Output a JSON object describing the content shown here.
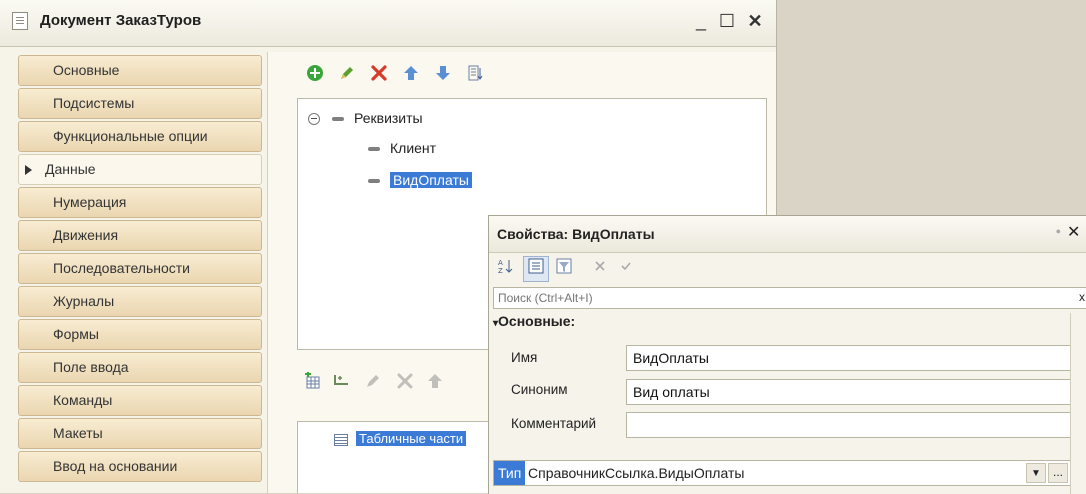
{
  "window": {
    "title": "Документ ЗаказТуров",
    "minimize": "_",
    "maximize": "☐",
    "close": "✕"
  },
  "tabs": [
    {
      "label": "Основные"
    },
    {
      "label": "Подсистемы"
    },
    {
      "label": "Функциональные опции"
    },
    {
      "label": "Данные"
    },
    {
      "label": "Нумерация"
    },
    {
      "label": "Движения"
    },
    {
      "label": "Последовательности"
    },
    {
      "label": "Журналы"
    },
    {
      "label": "Формы"
    },
    {
      "label": "Поле ввода"
    },
    {
      "label": "Команды"
    },
    {
      "label": "Макеты"
    },
    {
      "label": "Ввод на основании"
    }
  ],
  "active_tab_index": 3,
  "icons": {
    "add": "add-icon",
    "edit": "pencil-icon",
    "delete": "delete-icon",
    "up": "arrow-up-icon",
    "down": "arrow-down-icon",
    "sort": "sort-icon",
    "table": "table-icon"
  },
  "tree": {
    "root": "Реквизиты",
    "children": [
      "Клиент",
      "ВидОплаты"
    ],
    "selected": "ВидОплаты"
  },
  "tables_panel": {
    "item": "Табличные части"
  },
  "properties": {
    "title": "Свойства: ВидОплаты",
    "close": "✕",
    "search_placeholder": "Поиск (Ctrl+Alt+I)",
    "search_clear": "x",
    "section": "Основные:",
    "fields": [
      {
        "label": "Имя",
        "value": "ВидОплаты"
      },
      {
        "label": "Синоним",
        "value": "Вид оплаты"
      },
      {
        "label": "Комментарий",
        "value": ""
      }
    ],
    "type_label": "Тип",
    "type_value": "СправочникСсылка.ВидыОплаты",
    "type_more": "..."
  },
  "colors": {
    "selection": "#3b7bd6",
    "tab_bg": "#ead6b0",
    "window_bg": "#f6f4e8",
    "desktop": "#d9d4c6"
  }
}
